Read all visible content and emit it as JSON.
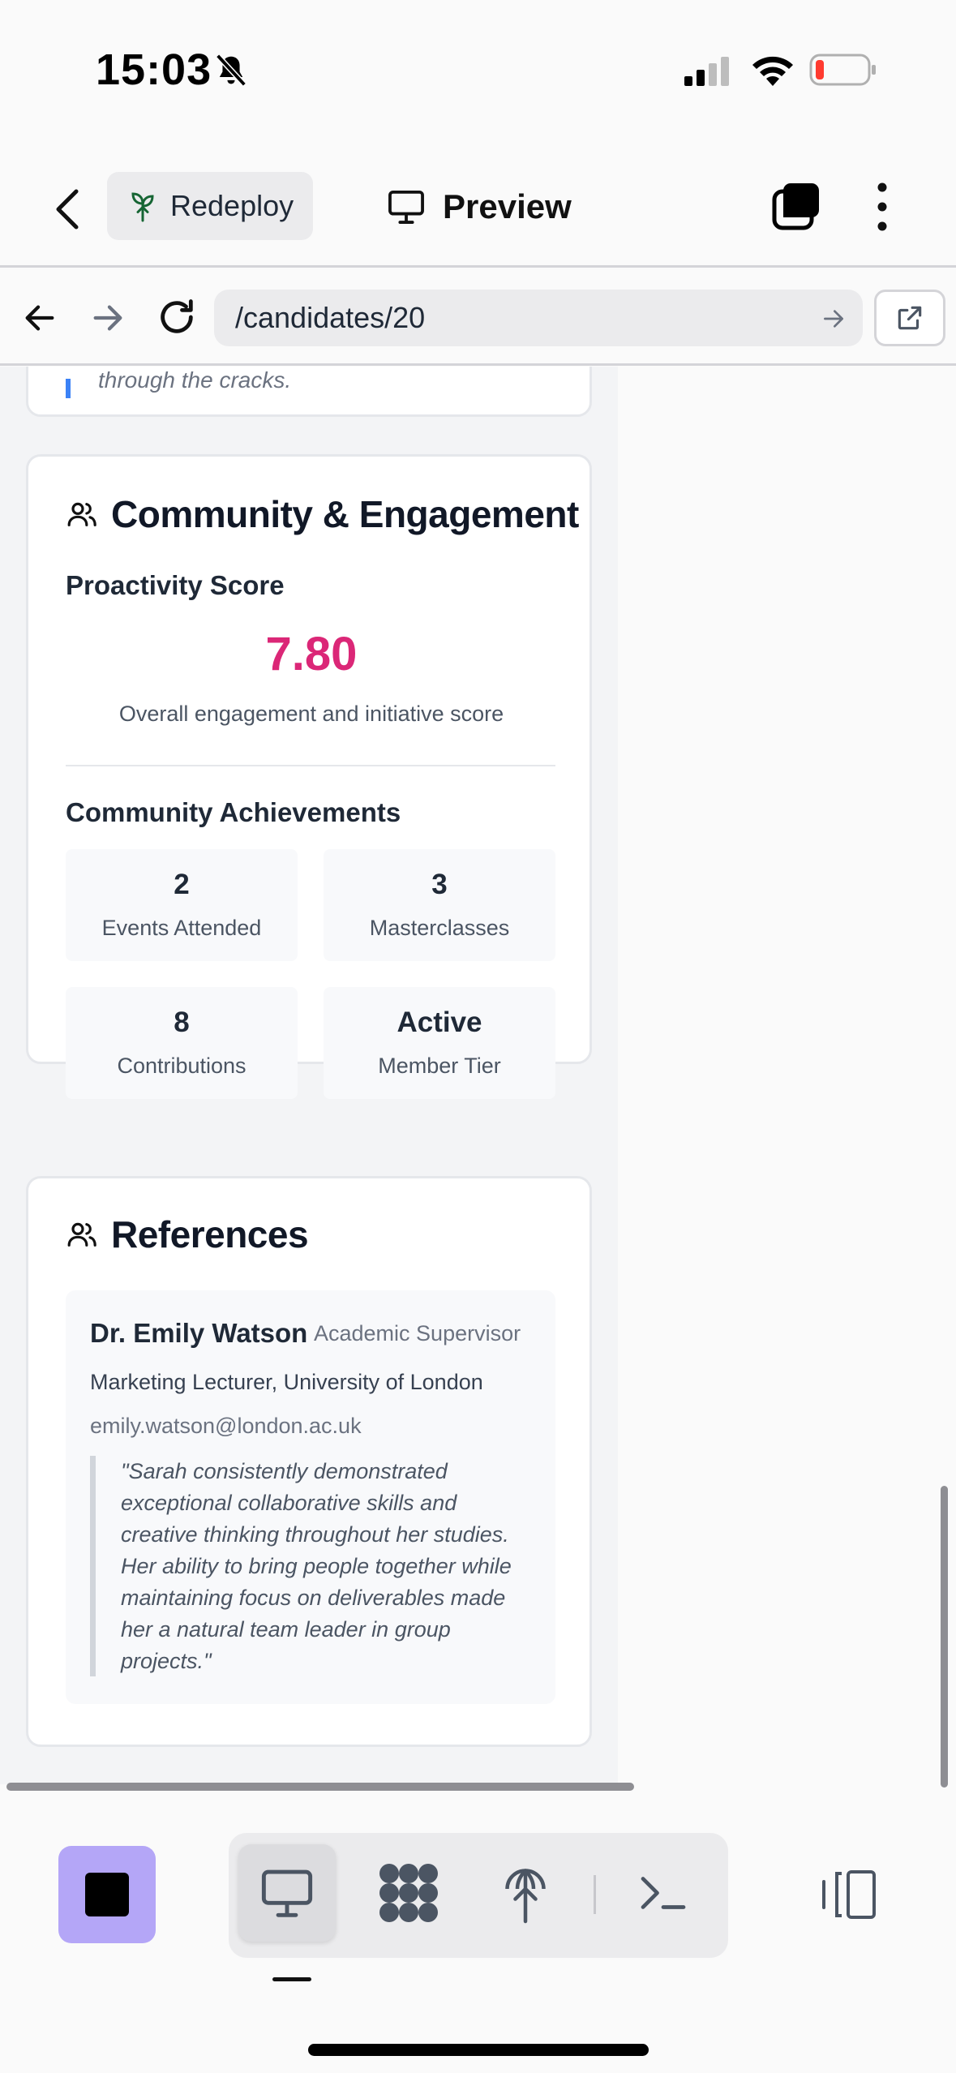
{
  "status_bar": {
    "time": "15:03"
  },
  "header": {
    "redeploy_label": "Redeploy",
    "preview_label": "Preview"
  },
  "browser": {
    "url": "/candidates/20"
  },
  "previous_card": {
    "trailing_text": "through the cracks."
  },
  "community": {
    "title": "Community & Engagement",
    "proactivity_label": "Proactivity Score",
    "proactivity_score": "7.80",
    "score_caption": "Overall engagement and initiative score",
    "achievements_label": "Community Achievements",
    "achievements": [
      {
        "value": "2",
        "label": "Events Attended"
      },
      {
        "value": "3",
        "label": "Masterclasses"
      },
      {
        "value": "8",
        "label": "Contributions"
      },
      {
        "value": "Active",
        "label": "Member Tier"
      }
    ]
  },
  "references": {
    "title": "References",
    "items": [
      {
        "name": "Dr. Emily Watson",
        "role": "Academic Supervisor",
        "position": "Marketing Lecturer, University of London",
        "email": "emily.watson@london.ac.uk",
        "quote": "\"Sarah consistently demonstrated exceptional collaborative skills and creative thinking throughout her studies. Her ability to bring people together while maintaining focus on deliverables made her a natural team leader in group projects.\""
      }
    ]
  },
  "colors": {
    "score": "#db2777",
    "stop_button": "#b4a6f7",
    "quote_accent": "#3b82f6"
  },
  "icons": [
    "bell-slash-icon",
    "signal-icon",
    "wifi-icon",
    "battery-icon",
    "chevron-left-icon",
    "sprout-icon",
    "monitor-icon",
    "layers-icon",
    "kebab-menu-icon",
    "arrow-left-icon",
    "arrow-right-icon",
    "reload-icon",
    "external-link-icon",
    "users-icon",
    "stop-icon",
    "grid-blob-icon",
    "deploy-icon",
    "terminal-icon",
    "side-panel-icon"
  ]
}
